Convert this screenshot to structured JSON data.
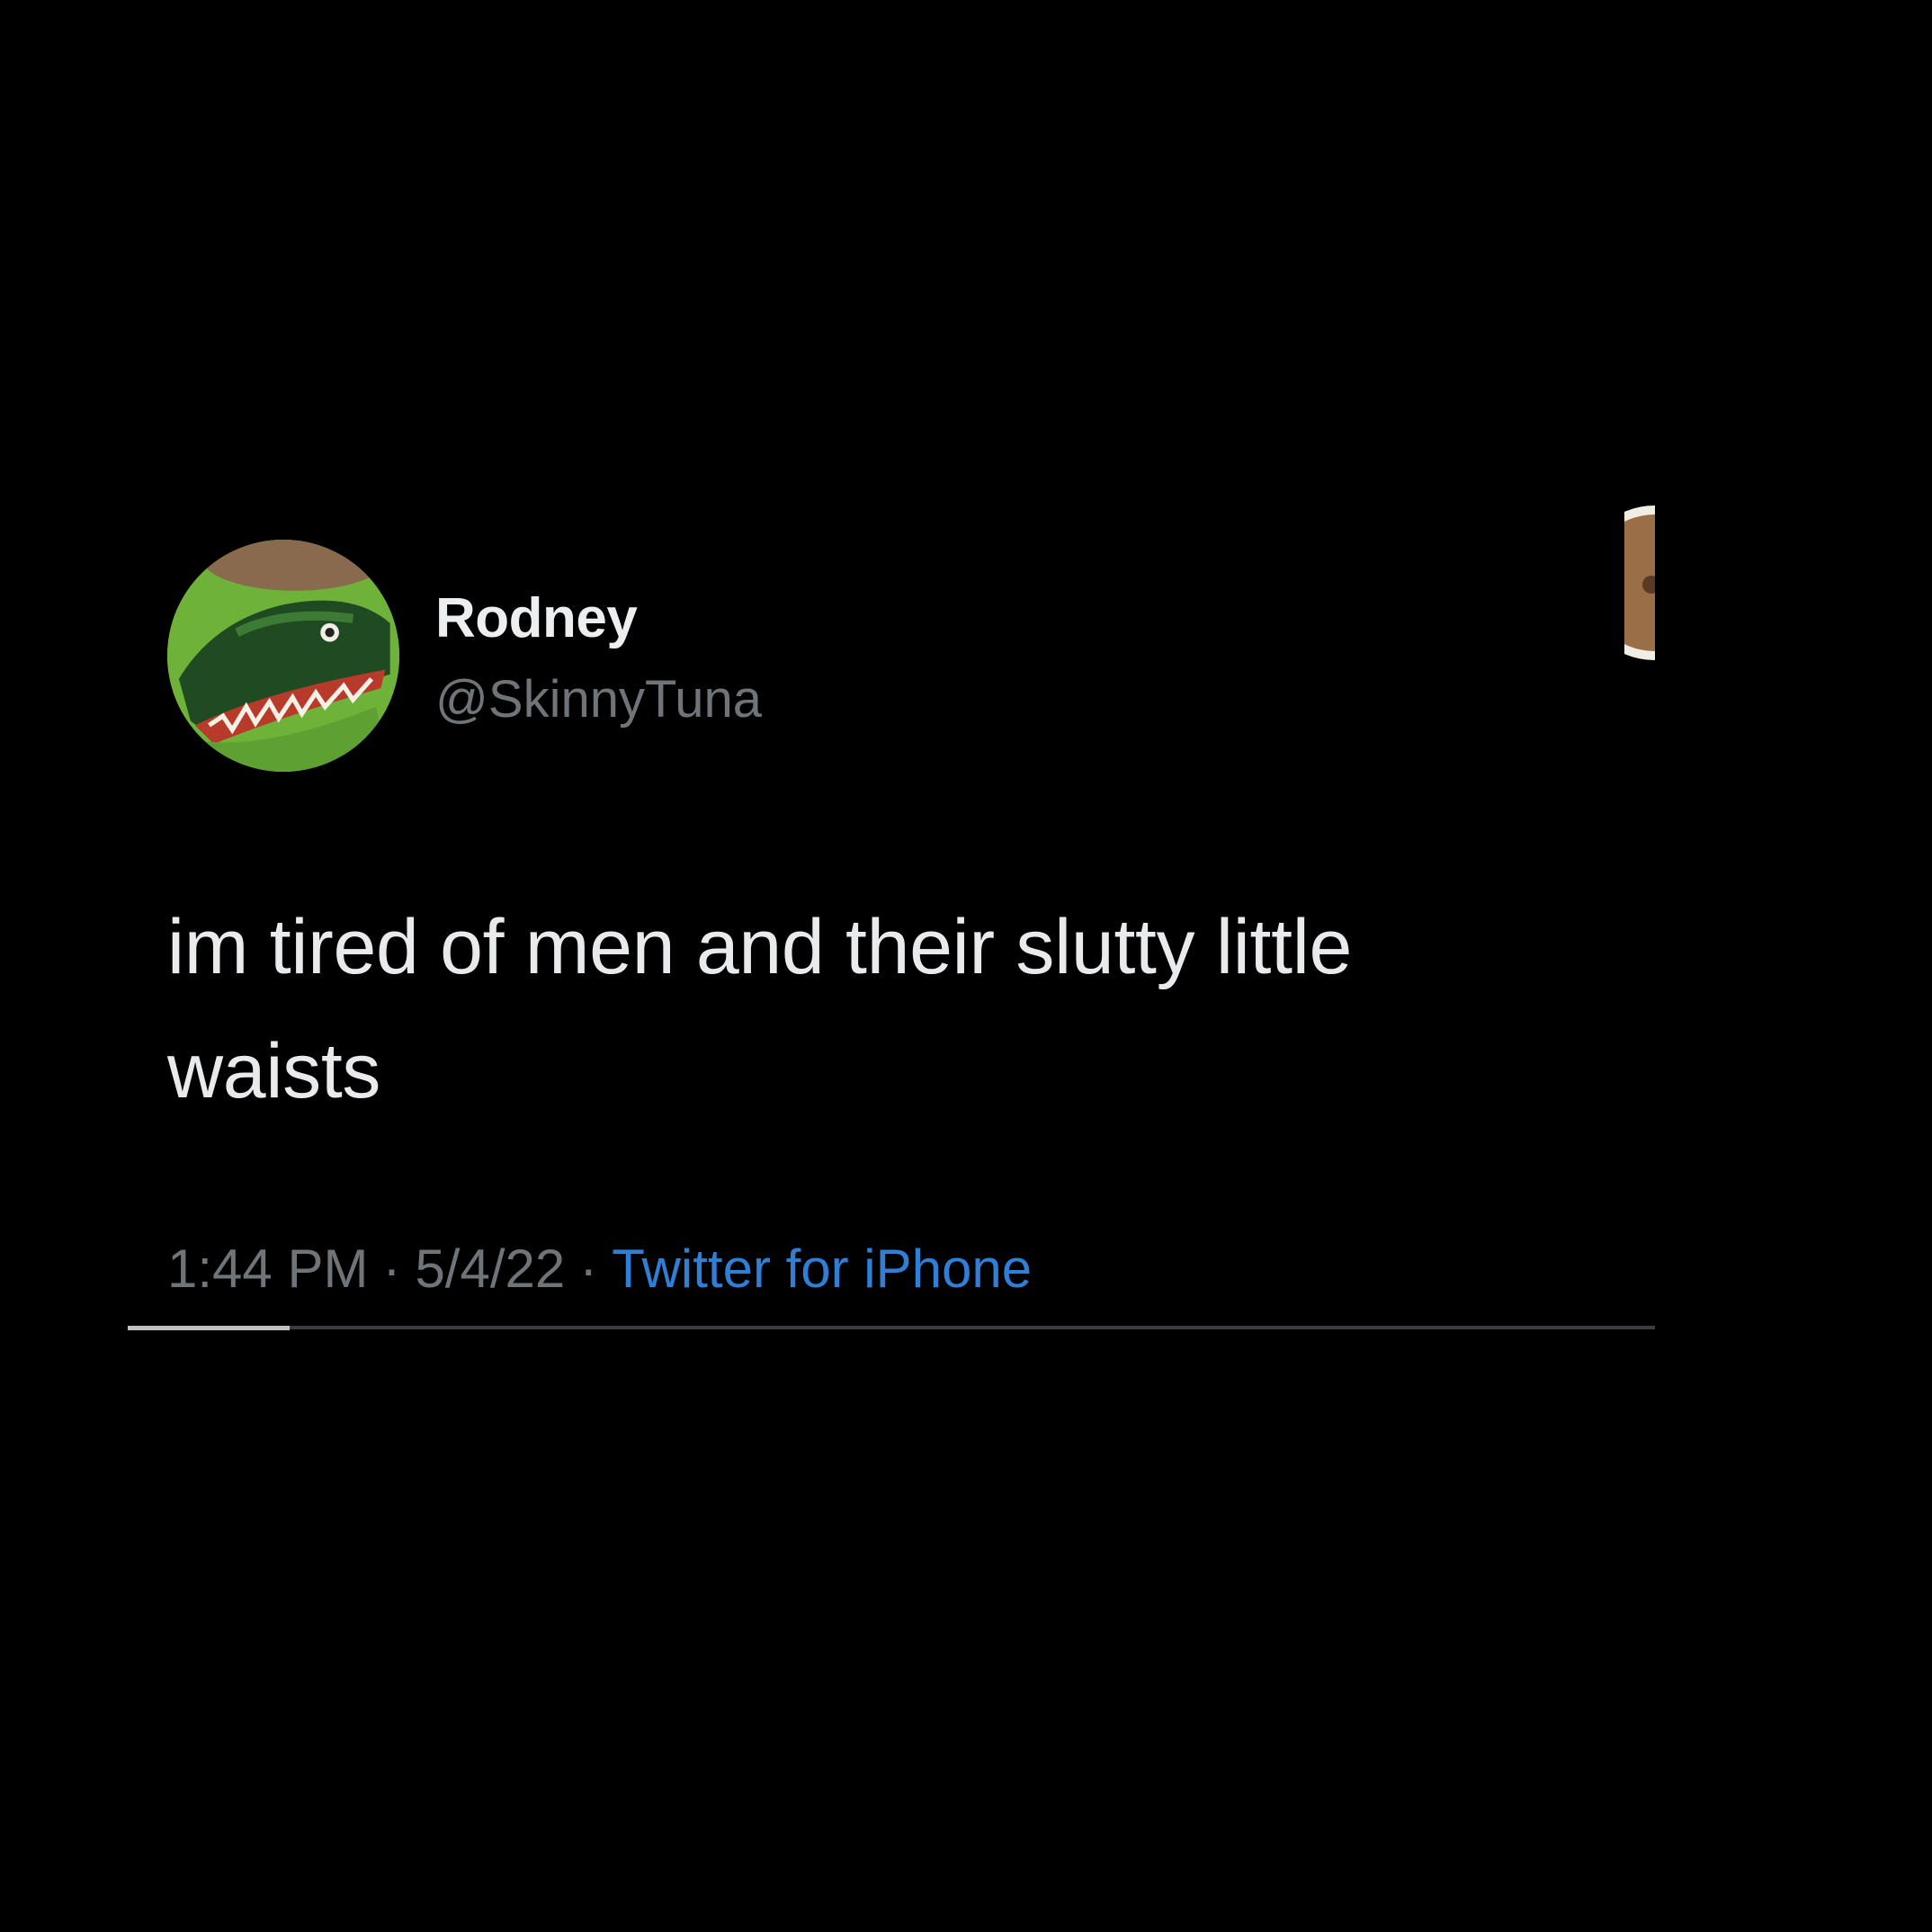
{
  "tweet": {
    "display_name": "Rodney",
    "handle": "@SkinnyTuna",
    "text_line1": "im tired of men and their slutty little",
    "text_line2": "waists",
    "time": "1:44 PM",
    "date": "5/4/22",
    "separator": "·",
    "source": "Twitter for iPhone"
  },
  "icons": {
    "avatar": "dinosaur-avatar-icon",
    "edge_avatar": "partial-avatar-icon"
  },
  "colors": {
    "background": "#000000",
    "text_primary": "#e8eaec",
    "text_secondary": "#6e7478",
    "link": "#2f7fd6",
    "avatar_bg": "#6fb23a"
  }
}
